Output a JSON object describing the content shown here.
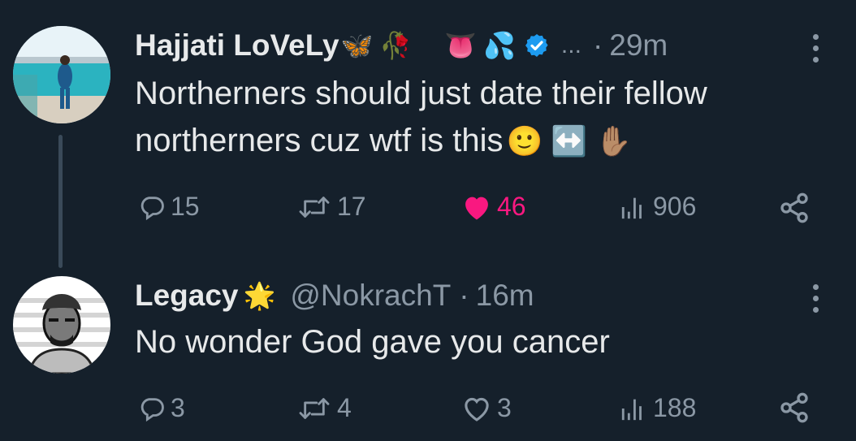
{
  "tweet1": {
    "display_name": "Hajjati LoVeLy",
    "name_emojis": [
      "🦋",
      "🥀",
      "👅",
      "💦"
    ],
    "verified": true,
    "ellipsis": "...",
    "separator": "·",
    "time": "29m",
    "text_line1": "Northerners should just date their fellow",
    "text_line2": "northerners cuz wtf is this",
    "text_emojis": [
      "🙂",
      "↔️",
      "✋🏽"
    ],
    "replies": "15",
    "retweets": "17",
    "likes": "46",
    "liked": true,
    "views": "906"
  },
  "tweet2": {
    "display_name": "Legacy",
    "name_emoji": "🌟",
    "handle": "@NokrachT",
    "separator": "·",
    "time": "16m",
    "text": "No wonder God gave you cancer",
    "replies": "3",
    "retweets": "4",
    "likes": "3",
    "liked": false,
    "views": "188"
  },
  "colors": {
    "background": "#15202b",
    "text": "#e7e9ea",
    "muted": "#8b98a5",
    "like": "#f91880",
    "verified": "#1d9bf0",
    "thread_line": "#3a4a59"
  }
}
